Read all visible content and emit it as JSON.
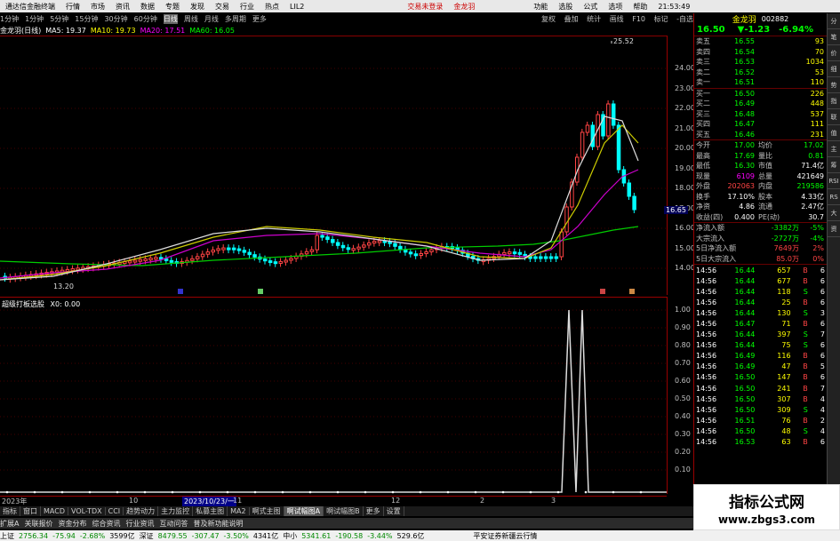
{
  "menu": {
    "app_title": "通达信金融终端",
    "items": [
      "行情",
      "市场",
      "资讯",
      "数据",
      "专题",
      "发现",
      "交易",
      "行业",
      "热点"
    ],
    "code": "LIL2",
    "alert1": "交易未登录",
    "alert2": "金龙羽",
    "right_items": [
      "功能",
      "选股",
      "公式",
      "选项",
      "帮助"
    ],
    "time": "21:53:49"
  },
  "periods": [
    "1分钟",
    "1分钟",
    "5分钟",
    "15分钟",
    "30分钟",
    "60分钟",
    "日线",
    "周线",
    "月线",
    "多周期",
    "更多"
  ],
  "right_tabs": [
    "复权",
    "叠加",
    "统计",
    "画线",
    "F10",
    "标记",
    "-自选"
  ],
  "ma": {
    "title": "金龙羽(日线)",
    "ma5": "MA5: 19.37",
    "ma10": "MA10: 19.73",
    "ma20": "MA20: 17.51",
    "ma60": "MA60: 16.05"
  },
  "y_axis1": [
    "24.00",
    "23.00",
    "22.00",
    "21.00",
    "20.00",
    "19.00",
    "18.00",
    "17.00",
    "16.00",
    "15.00",
    "14.00"
  ],
  "current_price_marker": "16.65",
  "high_label": "25.52",
  "low_label": "13.20",
  "indicator": {
    "title": "超级打板选股",
    "value": "X0: 0.00"
  },
  "y_axis2": [
    "1.00",
    "0.90",
    "0.80",
    "0.70",
    "0.60",
    "0.50",
    "0.40",
    "0.30",
    "0.20",
    "0.10"
  ],
  "dates": {
    "left": "2023年",
    "mid": "2023/10/23/一",
    "m10": "10",
    "m11": "11",
    "m12": "12",
    "m2": "2",
    "m3": "3"
  },
  "bottom_tabs": [
    "指标",
    "窗口",
    "MACD",
    "VOL-TDX",
    "CCI",
    "趋势动力",
    "主力监控",
    "私募主图",
    "MA2",
    "啊式主图",
    "啊试幅图A",
    "啊试幅图B",
    "更多",
    "设置"
  ],
  "bottom_sub": [
    "扩展A",
    "关联报价",
    "资金分布",
    "综合资讯",
    "行业资讯",
    "互动问答",
    "普及新功能说明"
  ],
  "stock": {
    "name": "金龙羽",
    "code": "002882",
    "price": "16.50",
    "change": "▼-1.23",
    "pct": "-6.94%"
  },
  "asks": [
    {
      "l": "卖五",
      "p": "16.55",
      "v": "93"
    },
    {
      "l": "卖四",
      "p": "16.54",
      "v": "70"
    },
    {
      "l": "卖三",
      "p": "16.53",
      "v": "1034"
    },
    {
      "l": "卖二",
      "p": "16.52",
      "v": "53"
    },
    {
      "l": "卖一",
      "p": "16.51",
      "v": "110"
    }
  ],
  "bids": [
    {
      "l": "买一",
      "p": "16.50",
      "v": "226"
    },
    {
      "l": "买二",
      "p": "16.49",
      "v": "448"
    },
    {
      "l": "买三",
      "p": "16.48",
      "v": "537"
    },
    {
      "l": "买四",
      "p": "16.47",
      "v": "111"
    },
    {
      "l": "买五",
      "p": "16.46",
      "v": "231"
    }
  ],
  "quote": [
    {
      "a": "今开",
      "b": "17.00",
      "c": "均价",
      "d": "17.02"
    },
    {
      "a": "最高",
      "b": "17.69",
      "c": "量比",
      "d": "0.81"
    },
    {
      "a": "最低",
      "b": "16.30",
      "c": "市值",
      "d": "71.4亿"
    },
    {
      "a": "现量",
      "b": "6109",
      "c": "总量",
      "d": "421649"
    },
    {
      "a": "外盘",
      "b": "202063",
      "c": "内盘",
      "d": "219586"
    },
    {
      "a": "换手",
      "b": "17.10%",
      "c": "股本",
      "d": "4.33亿"
    },
    {
      "a": "净资",
      "b": "4.86",
      "c": "流通",
      "d": "2.47亿"
    },
    {
      "a": "收益(四)",
      "b": "0.400",
      "c": "PE(动)",
      "d": "30.7"
    }
  ],
  "flows": [
    {
      "l": "净流入额",
      "v": "-3382万",
      "p": "-5%"
    },
    {
      "l": "大宗流入",
      "v": "-2727万",
      "p": "-4%"
    },
    {
      "l": "5日净流入额",
      "v": "7649万",
      "p": "2%"
    },
    {
      "l": "5日大宗流入",
      "v": "85.0万",
      "p": "0%"
    }
  ],
  "ticks": [
    {
      "t": "14:56",
      "p": "16.44",
      "v": "657",
      "s": "B",
      "n": "6"
    },
    {
      "t": "14:56",
      "p": "16.44",
      "v": "677",
      "s": "B",
      "n": "6"
    },
    {
      "t": "14:56",
      "p": "16.44",
      "v": "118",
      "s": "S",
      "n": "6"
    },
    {
      "t": "14:56",
      "p": "16.44",
      "v": "25",
      "s": "B",
      "n": "6"
    },
    {
      "t": "14:56",
      "p": "16.44",
      "v": "130",
      "s": "S",
      "n": "3"
    },
    {
      "t": "14:56",
      "p": "16.47",
      "v": "71",
      "s": "B",
      "n": "6"
    },
    {
      "t": "14:56",
      "p": "16.44",
      "v": "397",
      "s": "S",
      "n": "7"
    },
    {
      "t": "14:56",
      "p": "16.44",
      "v": "75",
      "s": "S",
      "n": "6"
    },
    {
      "t": "14:56",
      "p": "16.49",
      "v": "116",
      "s": "B",
      "n": "6"
    },
    {
      "t": "14:56",
      "p": "16.49",
      "v": "47",
      "s": "B",
      "n": "5"
    },
    {
      "t": "14:56",
      "p": "16.50",
      "v": "147",
      "s": "B",
      "n": "6"
    },
    {
      "t": "14:56",
      "p": "16.50",
      "v": "241",
      "s": "B",
      "n": "7"
    },
    {
      "t": "14:56",
      "p": "16.50",
      "v": "307",
      "s": "B",
      "n": "4"
    },
    {
      "t": "14:56",
      "p": "16.50",
      "v": "309",
      "s": "S",
      "n": "4"
    },
    {
      "t": "14:56",
      "p": "16.51",
      "v": "76",
      "s": "B",
      "n": "2"
    },
    {
      "t": "14:56",
      "p": "16.50",
      "v": "48",
      "s": "S",
      "n": "4"
    },
    {
      "t": "14:56",
      "p": "16.53",
      "v": "63",
      "s": "B",
      "n": "6"
    }
  ],
  "status": {
    "sh_name": "上证",
    "sh": "2756.34",
    "sh_ch": "-75.94",
    "sh_pct": "-2.68%",
    "sh_amt": "3599亿",
    "sz_name": "深证",
    "sz": "8479.55",
    "sz_ch": "-307.47",
    "sz_pct": "-3.50%",
    "sz_amt": "4341亿",
    "zx_name": "中小",
    "zx": "5341.61",
    "zx_ch": "-190.58",
    "zx_pct": "-3.44%",
    "zx_amt": "529.6亿",
    "broker": "平安证券新疆云行情"
  },
  "watermark": {
    "line1": "指标公式网",
    "line2": "www.zbgs3.com"
  },
  "side_labels": [
    "分",
    "笔",
    "价",
    "细",
    "势",
    "指",
    "联",
    "值",
    "主",
    "筹",
    "RSI",
    "RS",
    "大",
    "资"
  ]
}
